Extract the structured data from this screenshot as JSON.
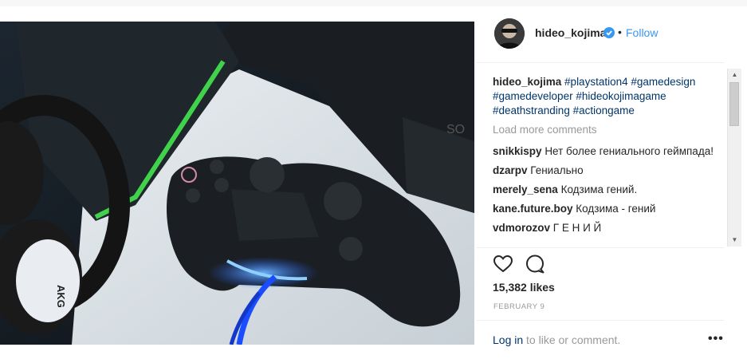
{
  "post": {
    "author": {
      "username": "hideo_kojima",
      "verified": true,
      "verified_icon": "verified-badge-icon",
      "follow_label": "Follow",
      "separator": "•"
    },
    "image": {
      "description_icon": "photo-icon",
      "brand_text": "AKG"
    },
    "caption": {
      "username": "hideo_kojima",
      "tags": [
        "#playstation4",
        "#gamedesign",
        "#gamedeveloper",
        "#hideokojimagame",
        "#deathstranding",
        "#actiongame"
      ]
    },
    "load_more_label": "Load more comments",
    "comments": [
      {
        "username": "snikkispy",
        "text": "Нет более гениального геймпада!"
      },
      {
        "username": "dzarpv",
        "text": "Гениально"
      },
      {
        "username": "merely_sena",
        "text": "Кодзима гений."
      },
      {
        "username": "kane.future.boy",
        "text": "Кодзима - гений"
      },
      {
        "username": "vdmorozov",
        "text": "Г Е Н И Й"
      }
    ],
    "likes_label": "15,382 likes",
    "date_label": "FEBRUARY 9",
    "login": {
      "link_label": "Log in",
      "suffix": " to like or comment."
    },
    "more_label": "•••",
    "colors": {
      "link_blue": "#3897f0",
      "tag_navy": "#003569",
      "muted_gray": "#999999"
    }
  }
}
